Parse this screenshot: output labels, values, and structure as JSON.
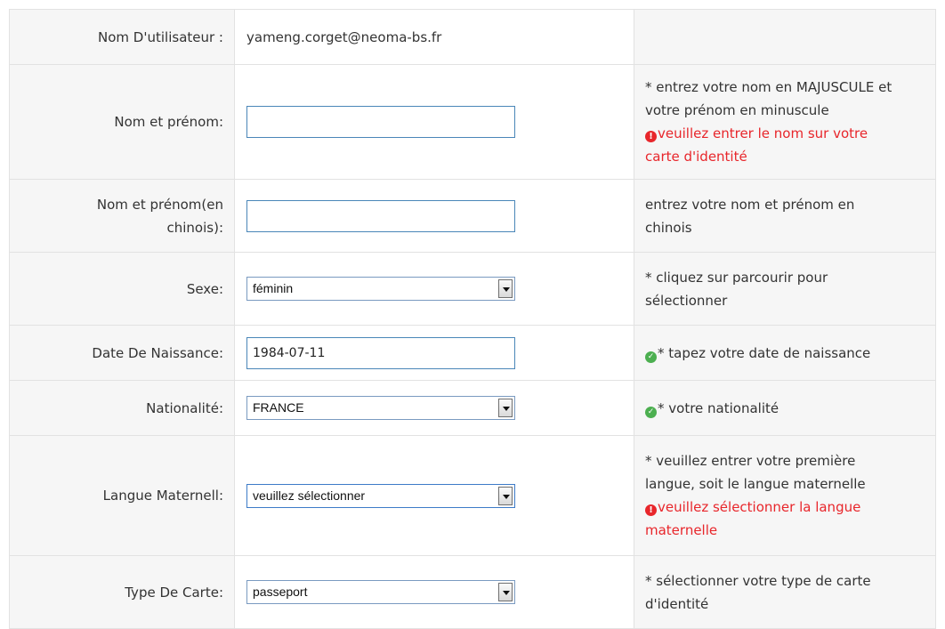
{
  "rows": {
    "username": {
      "label": "Nom D'utilisateur :",
      "value": "yameng.corget@neoma-bs.fr"
    },
    "fullname": {
      "label": "Nom et prénom:",
      "value": "",
      "hint_lines": [
        "* entrez votre nom en MAJUSCULE et",
        "votre prénom en minuscule"
      ],
      "error_lines": [
        "veuillez entrer le nom sur votre",
        "carte d'identité"
      ]
    },
    "fullname_cn": {
      "label_lines": [
        "Nom et prénom(en",
        "chinois):"
      ],
      "value": "",
      "hint_lines": [
        "entrez votre nom et prénom en",
        "chinois"
      ]
    },
    "sex": {
      "label": "Sexe:",
      "selected": "féminin",
      "hint_lines": [
        "* cliquez sur parcourir pour",
        "sélectionner"
      ]
    },
    "birthdate": {
      "label": "Date De Naissance:",
      "value": "1984-07-11",
      "hint": "* tapez votre date de naissance"
    },
    "nationality": {
      "label": "Nationalité:",
      "selected": "FRANCE",
      "hint": "* votre nationalité"
    },
    "mother_tongue": {
      "label": "Langue Maternell:",
      "selected": "veuillez sélectionner",
      "hint_lines": [
        "* veuillez entrer votre première",
        "langue, soit le langue maternelle"
      ],
      "error_lines": [
        "veuillez sélectionner la langue",
        "maternelle"
      ]
    },
    "card_type": {
      "label": "Type De Carte:",
      "selected": "passeport",
      "hint_lines": [
        "* sélectionner votre type de carte",
        "d'identité"
      ]
    }
  },
  "icons": {
    "error": "exclamation-circle-icon",
    "ok": "check-circle-icon"
  },
  "colors": {
    "error": "#e8262b",
    "ok": "#4caf50",
    "label_bg": "#f6f6f6",
    "border": "#e2e2e2"
  }
}
